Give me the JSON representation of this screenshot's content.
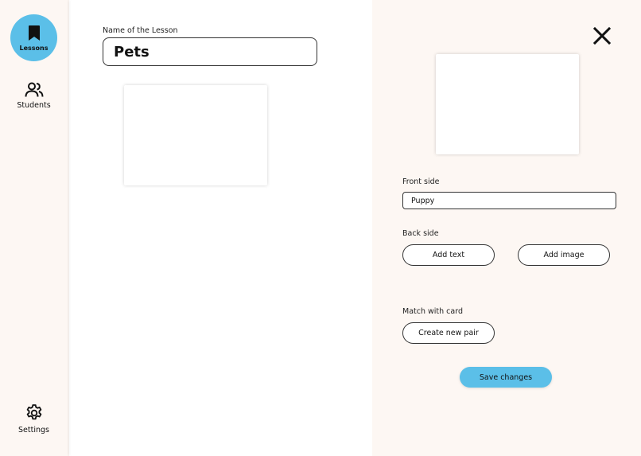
{
  "sidebar": {
    "lessons_label": "Lessons",
    "students_label": "Students",
    "settings_label": "Settings"
  },
  "lesson": {
    "name_label": "Name of the Lesson",
    "name_value": "Pets"
  },
  "editor": {
    "front_label": "Front side",
    "front_value": "Puppy",
    "back_label": "Back side",
    "add_text_label": "Add text",
    "add_image_label": "Add image",
    "match_label": "Match with card",
    "create_pair_label": "Create new pair",
    "save_label": "Save changes"
  },
  "colors": {
    "accent": "#5bbfe8",
    "background": "#fdf7f3",
    "panel": "#ffffff"
  },
  "icons": {
    "lessons": "bookmark-icon",
    "students": "users-icon",
    "settings": "gear-icon",
    "close": "close-icon"
  }
}
